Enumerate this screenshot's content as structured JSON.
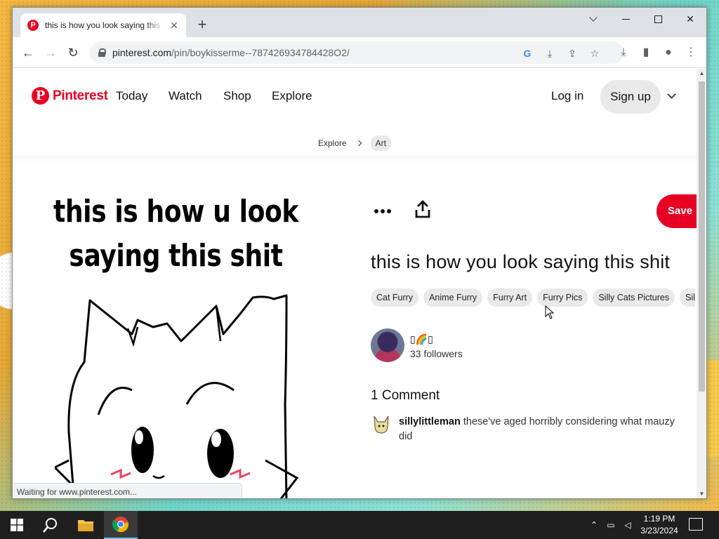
{
  "browser": {
    "tab_title": "this is how you look saying this shit | Pinterest",
    "new_tab_label": "+",
    "url_host": "pinterest.com",
    "url_path": "/pin/boykisserme--787426934784428O2/"
  },
  "site": {
    "logo_text": "Pinterest",
    "nav": [
      "Today",
      "Watch",
      "Shop",
      "Explore"
    ],
    "login_label": "Log in",
    "signup_label": "Sign up",
    "breadcrumb": [
      "Explore",
      "Art"
    ]
  },
  "pin": {
    "image_text_line1": "this is how u look",
    "image_text_line2": "saying this shit",
    "save_label": "Save",
    "title": "this is how you look saying this shit",
    "tags": [
      "Cat Furry",
      "Anime Furry",
      "Furry Art",
      "Furry Pics",
      "Silly Cats Pictures",
      "Silly Images"
    ],
    "creator_name": "▯🌈▯",
    "creator_followers": "33 followers",
    "comments_title": "1 Comment",
    "comments": [
      {
        "user": "sillylittleman",
        "text": "these've aged horribly considering what mauzy did"
      }
    ]
  },
  "status": {
    "text": "Waiting for www.pinterest.com..."
  },
  "taskbar": {
    "time": "1:19 PM",
    "date": "3/23/2024"
  },
  "colors": {
    "brand": "#e60023",
    "pill_bg": "#e9e9e9"
  }
}
